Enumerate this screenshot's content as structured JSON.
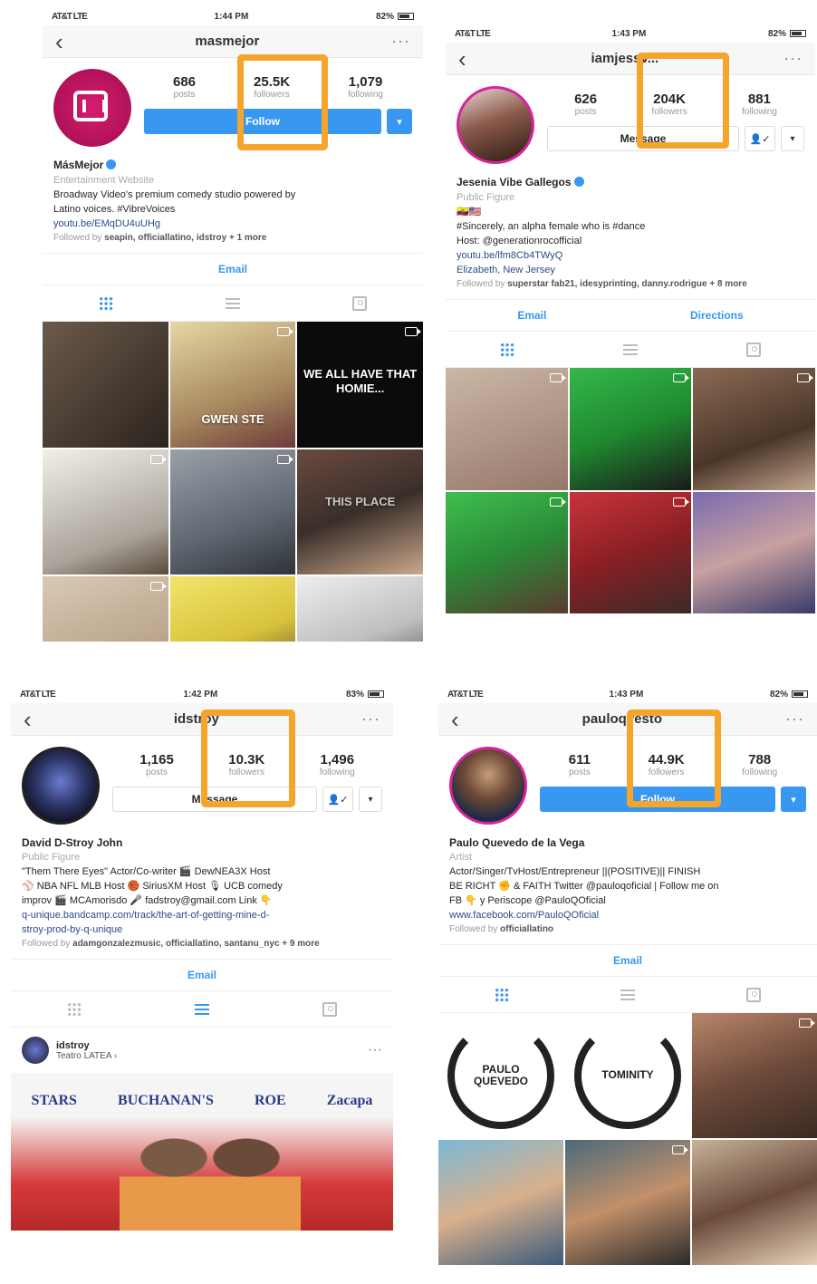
{
  "colors": {
    "accent": "#3897f0",
    "highlight": "#f5a42c"
  },
  "p1": {
    "status": {
      "carrier": "AT&T LTE",
      "time": "1:44 PM",
      "battery": "82%"
    },
    "username": "masmejor",
    "stats": [
      {
        "num": "686",
        "label": "posts"
      },
      {
        "num": "25.5K",
        "label": "followers"
      },
      {
        "num": "1,079",
        "label": "following"
      }
    ],
    "follow": "Follow",
    "name": "MásMejor",
    "category": "Entertainment Website",
    "bio1": "Broadway Video's premium comedy studio powered by",
    "bio2": "Latino voices. #VibreVoices",
    "link": "youtu.be/EMqDU4uUHg",
    "followed_prefix": "Followed by",
    "followed_names": "seapin, officiallatino, idstroy",
    "followed_suffix": "+ 1 more",
    "contact": "Email",
    "tiles": [
      "WE ALL HAVE THAT HOMIE...",
      "GWEN STE",
      "THIS PLACE"
    ]
  },
  "p2": {
    "status": {
      "carrier": "AT&T LTE",
      "time": "1:43 PM",
      "battery": "82%"
    },
    "username": "iamjessv...",
    "stats": [
      {
        "num": "626",
        "label": "posts"
      },
      {
        "num": "204K",
        "label": "followers"
      },
      {
        "num": "881",
        "label": "following"
      }
    ],
    "message": "Message",
    "name": "Jesenia Vibe Gallegos",
    "category": "Public Figure",
    "bio1": "#Sincerely, an alpha female who is #dance",
    "bio2": "Host: @generationrocofficial",
    "link": "youtu.be/lfm8Cb4TWyQ",
    "location": "Elizabeth, New Jersey",
    "followed_prefix": "Followed by",
    "followed_names": "superstar fab21, idesyprinting, danny.rodrigue",
    "followed_suffix": "+ 8 more",
    "contact1": "Email",
    "contact2": "Directions"
  },
  "p3": {
    "status": {
      "carrier": "AT&T LTE",
      "time": "1:42 PM",
      "battery": "83%"
    },
    "username": "idstroy",
    "stats": [
      {
        "num": "1,165",
        "label": "posts"
      },
      {
        "num": "10.3K",
        "label": "followers"
      },
      {
        "num": "1,496",
        "label": "following"
      }
    ],
    "message": "Message",
    "name": "David D-Stroy John",
    "category": "Public Figure",
    "bio1": "\"Them There Eyes\" Actor/Co-writer 🎬 DewNEA3X Host",
    "bio2": "⚾ NBA NFL MLB Host 🏀 SiriusXM Host 🎙 UCB comedy",
    "bio3": "improv 🎬 MCAmorisdo 🎤 fadstroy@gmail.com Link 👇",
    "link1": "q-unique.bandcamp.com/track/the-art-of-getting-mine-d-",
    "link2": "stroy-prod-by-q-unique",
    "followed_prefix": "Followed by",
    "followed_names": "adamgonzalezmusic, officiallatino, santanu_nyc",
    "followed_suffix": "+ 9 more",
    "contact": "Email",
    "post": {
      "user": "idstroy",
      "location": "Teatro LATEA ›"
    },
    "banner": [
      "STARS",
      "BUCHANAN'S",
      "ROE",
      "Zacapa"
    ]
  },
  "p4": {
    "status": {
      "carrier": "AT&T LTE",
      "time": "1:43 PM",
      "battery": "82%"
    },
    "username": "pauloqvesto",
    "stats": [
      {
        "num": "611",
        "label": "posts"
      },
      {
        "num": "44.9K",
        "label": "followers"
      },
      {
        "num": "788",
        "label": "following"
      }
    ],
    "follow": "Follow",
    "name": "Paulo Quevedo de la Vega",
    "category": "Artist",
    "bio1": "Actor/Singer/TvHost/Entrepreneur ||(POSITIVE)|| FINISH",
    "bio2": "BE RICHT ✊ & FAITH Twitter @pauloqoficial | Follow me on",
    "bio3": "FB 👇 y Periscope @PauloQOficial",
    "link": "www.facebook.com/PauloQOficial",
    "followed_prefix": "Followed by",
    "followed_names": "officiallatino",
    "contact": "Email",
    "laurels": [
      "PAULO QUEVEDO",
      "TOMINITY"
    ]
  }
}
